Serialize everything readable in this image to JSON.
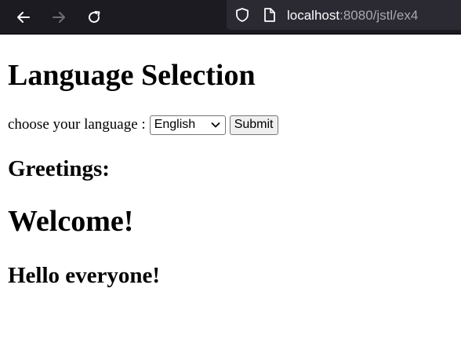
{
  "browser": {
    "url_host": "localhost",
    "url_rest": ":8080/jstl/ex4",
    "icons": {
      "back": "arrow-left-icon",
      "forward": "arrow-right-icon",
      "reload": "reload-icon",
      "security": "shield-icon",
      "page": "page-icon"
    }
  },
  "page": {
    "title": "Language Selection",
    "choose_label": "choose your language :",
    "language_select": {
      "selected": "English"
    },
    "submit_label": "Submit",
    "greetings_label": "Greetings:",
    "welcome_text": "Welcome!",
    "hello_text": "Hello everyone!"
  }
}
